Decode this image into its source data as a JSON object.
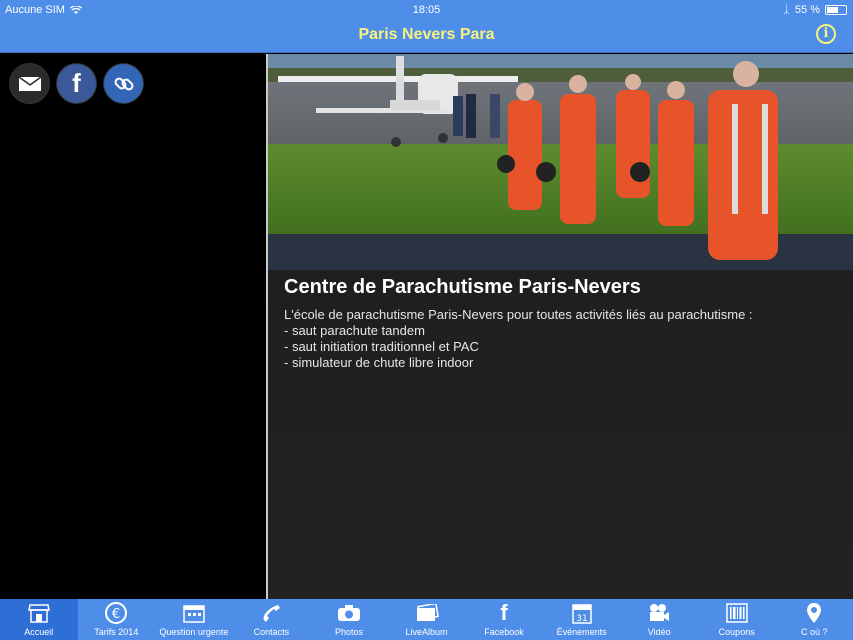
{
  "status": {
    "carrier": "Aucune SIM",
    "time": "18:05",
    "battery": "55 %"
  },
  "header": {
    "title": "Paris Nevers Para"
  },
  "social": [
    "mail-icon",
    "facebook-icon",
    "link-icon"
  ],
  "main": {
    "heading": "Centre de Parachutisme Paris-Nevers",
    "lines": [
      "L'école de parachutisme Paris-Nevers pour toutes activités liés au parachutisme :",
      "- saut parachute tandem",
      "- saut initiation traditionnel et PAC",
      "- simulateur de chute libre indoor"
    ]
  },
  "tabs": [
    {
      "label": "Accueil",
      "icon": "shop-icon"
    },
    {
      "label": "Tarifs 2014",
      "icon": "euro-icon"
    },
    {
      "label": "Question urgente",
      "icon": "calendar-icon"
    },
    {
      "label": "Contacts",
      "icon": "phone-icon"
    },
    {
      "label": "Photos",
      "icon": "camera-icon"
    },
    {
      "label": "LiveAlbum",
      "icon": "album-icon"
    },
    {
      "label": "Facebook",
      "icon": "facebook-icon"
    },
    {
      "label": "Événements",
      "icon": "calendar-icon"
    },
    {
      "label": "Vidéo",
      "icon": "video-icon"
    },
    {
      "label": "Coupons",
      "icon": "barcode-icon"
    },
    {
      "label": "C où ?",
      "icon": "pin-icon"
    }
  ],
  "colors": {
    "bar": "#4f8ee8",
    "title": "#f7f27c",
    "active_tab": "#2e6fd6"
  }
}
